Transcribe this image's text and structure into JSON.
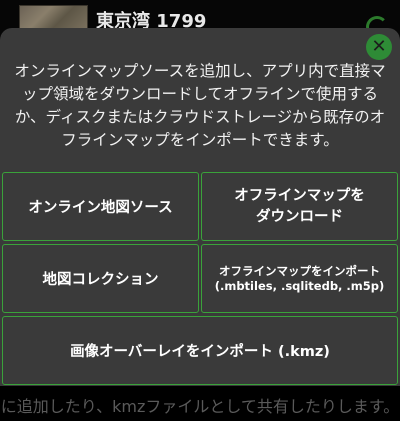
{
  "background": {
    "title": "東京湾 1799",
    "footer_text": "に追加したり、kmzファイルとして共有したりします。"
  },
  "dialog": {
    "description": "オンラインマップソースを追加し、アプリ内で直接マップ領域をダウンロードしてオフラインで使用するか、ディスクまたはクラウドストレージから既存のオフラインマップをインポートできます。",
    "close_symbol": "✕",
    "buttons": {
      "online_source": "オンライン地図ソース",
      "download_line1": "オフラインマップを",
      "download_line2": "ダウンロード",
      "collection": "地図コレクション",
      "import_line1": "オフラインマップをインポート",
      "import_line2": "(.mbtiles, .sqlitedb, .m5p)",
      "overlay": "画像オーバーレイをインポート (.kmz)"
    }
  },
  "colors": {
    "accent": "#3aa23a",
    "dialog_bg": "#3a3a3a",
    "close_bg": "#2e8b36"
  }
}
